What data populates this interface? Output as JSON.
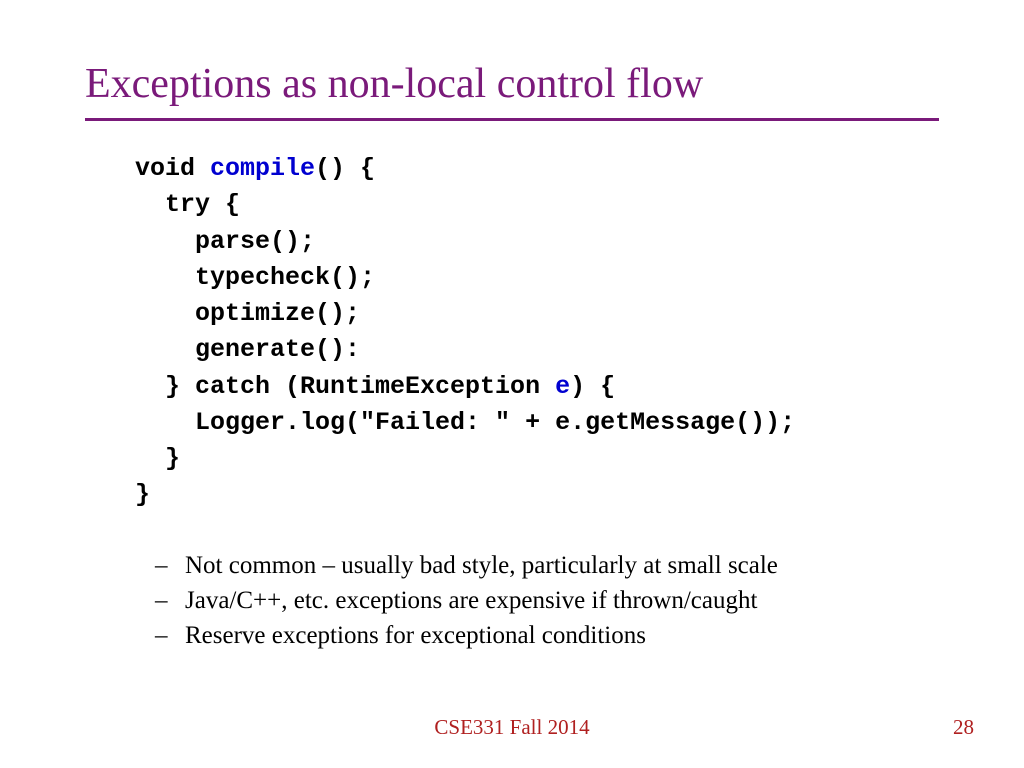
{
  "title": "Exceptions as non-local control flow",
  "code": {
    "l1a": "void ",
    "l1b": "compile",
    "l1c": "() {",
    "l2": "  try {",
    "l3": "    parse();",
    "l4": "    typecheck();",
    "l5": "    optimize();",
    "l6": "    generate():",
    "l7a": "  } catch (RuntimeException ",
    "l7b": "e",
    "l7c": ") {",
    "l8": "    Logger.log(\"Failed: \" + e.getMessage());",
    "l9": "  }",
    "l10": "}"
  },
  "bullets": [
    "Not common – usually bad style, particularly at small scale",
    "Java/C++, etc. exceptions are expensive if thrown/caught",
    "Reserve exceptions for exceptional conditions"
  ],
  "dash": "–",
  "footer": {
    "course": "CSE331 Fall 2014",
    "page": "28"
  }
}
